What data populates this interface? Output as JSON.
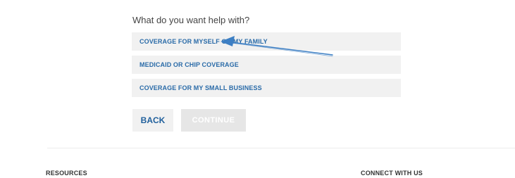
{
  "form": {
    "question": "What do you want help with?",
    "options": [
      "COVERAGE FOR MYSELF OR MY FAMILY",
      "MEDICAID OR CHIP COVERAGE",
      "COVERAGE FOR MY SMALL BUSINESS"
    ],
    "back_label": "BACK",
    "continue_label": "CONTINUE"
  },
  "footer": {
    "resources_heading": "RESOURCES",
    "connect_heading": "CONNECT WITH US"
  },
  "colors": {
    "link_blue": "#2a6ba8",
    "option_bg": "#f1f1f1",
    "disabled_bg": "#e6e6e6",
    "annotation_blue": "#3d7fc4"
  },
  "icons": {
    "annotation": "arrow-pointer-icon"
  }
}
